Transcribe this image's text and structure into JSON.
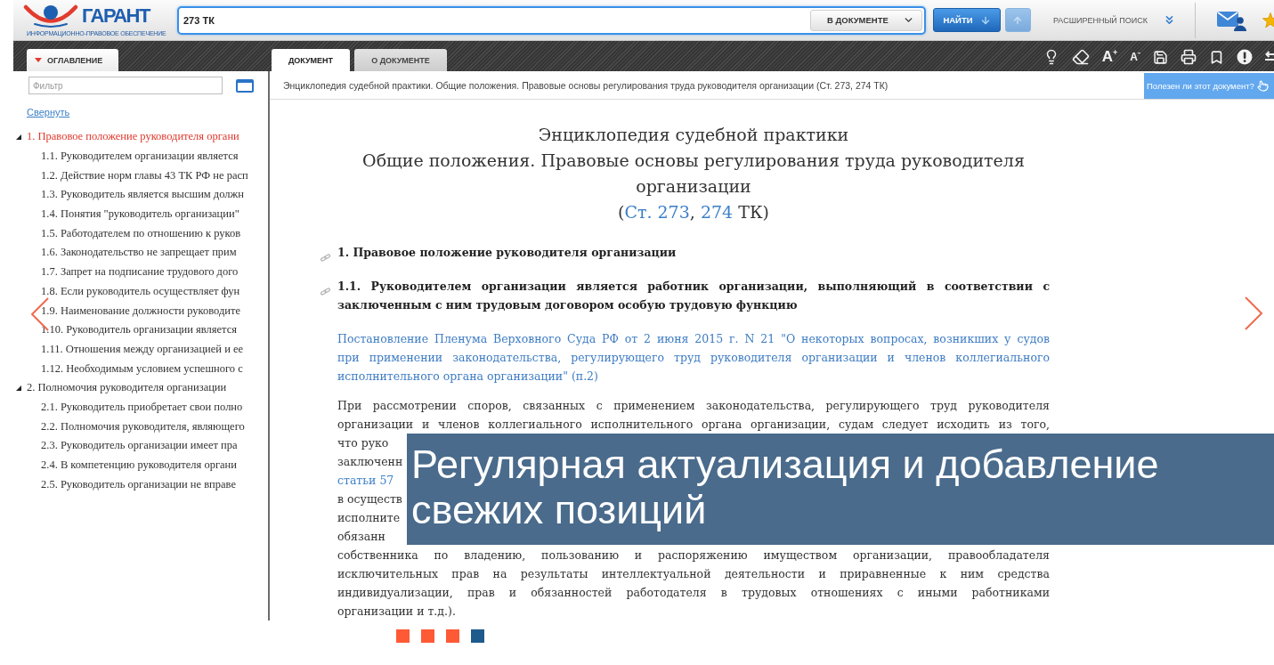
{
  "slide": {
    "logo": {
      "name": "ГАРАНТ",
      "tagline": "ИНФОРМАЦИОННО-ПРАВОВОЕ ОБЕСПЕЧЕНИЕ"
    },
    "search": {
      "value": "273 ТК",
      "scope": "В ДОКУМЕНТЕ",
      "find": "НАЙТИ",
      "previous_result": {
        "disabled": true
      },
      "advanced": "РАСШИРЕННЫЙ ПОИСК"
    },
    "sidebar": {
      "tab": "ОГЛАВЛЕНИЕ",
      "filter": {
        "placeholder": "Фильтр"
      },
      "collapse": "Свернуть",
      "items": [
        {
          "label": "1. Правовое положение руководителя органи",
          "selected": true,
          "expanded": true,
          "children": [
            {
              "label": "1.1. Руководителем организации является",
              "selected": false
            },
            {
              "label": "1.2. Действие норм главы 43 ТК РФ не расп",
              "selected": false
            },
            {
              "label": "1.3. Руководитель является высшим должн",
              "selected": false
            },
            {
              "label": "1.4. Понятия \"руководитель организации\"",
              "selected": false
            },
            {
              "label": "1.5. Работодателем по отношению к руков",
              "selected": false
            },
            {
              "label": "1.6. Законодательство не запрещает прим",
              "selected": false
            },
            {
              "label": "1.7. Запрет на подписание трудового дого",
              "selected": false
            },
            {
              "label": "1.8. Если руководитель осуществляет фун",
              "selected": false
            },
            {
              "label": "1.9. Наименование должности руководите",
              "selected": false
            },
            {
              "label": "1.10. Руководитель организации является",
              "selected": false
            },
            {
              "label": "1.11. Отношения между организацией и ее",
              "selected": false
            },
            {
              "label": "1.12. Необходимым условием успешного с",
              "selected": false
            }
          ]
        },
        {
          "label": "2. Полномочия руководителя организации",
          "selected": false,
          "expanded": true,
          "children": [
            {
              "label": "2.1. Руководитель приобретает свои полно",
              "selected": false
            },
            {
              "label": "2.2. Полномочия руководителя, являющего",
              "selected": false
            },
            {
              "label": "2.3. Руководитель организации имеет пра",
              "selected": false
            },
            {
              "label": "2.4. В компетенцию руководителя органи",
              "selected": false
            },
            {
              "label": "2.5. Руководитель организации не вправе",
              "selected": false
            }
          ]
        }
      ]
    },
    "document_tabs": [
      {
        "label": "ДОКУМЕНТ",
        "selected": true
      },
      {
        "label": "О ДОКУМЕНТЕ",
        "selected": false
      }
    ],
    "toolbar": {
      "font_larger": "A$^{+}$",
      "font_smaller": "A$^{-}$"
    },
    "breadcrumb": "Энциклопедия судебной практики. Общие положения. Правовые основы регулирования труда руководителя организации (Ст. 273, 274 ТК)",
    "feedback": "Полезен ли этот документ?",
    "document": {
      "title": "Энциклопедия судебной практики",
      "subtitle_lines": [
        "Общие положения. Правовые основы регулирования труда руководителя",
        "организации"
      ],
      "references": [
        {
          "kind": "text",
          "text": "("
        },
        {
          "kind": "link",
          "text": "Ст. 273"
        },
        {
          "kind": "text",
          "text": ", "
        },
        {
          "kind": "link",
          "text": "274"
        },
        {
          "kind": "text",
          "text": " ТК)"
        }
      ],
      "blocks": [
        {
          "kind": "heading",
          "lines": [
            {
              "parts": [
                {
                  "kind": "text",
                  "text": "1. Правовое положение руководителя организации"
                }
              ]
            }
          ]
        },
        {
          "kind": "heading",
          "lines": [
            {
              "parts": [
                {
                  "kind": "text",
                  "text": "1.1. Руководителем организации является работник организации, выполняющий в соответствии с"
                }
              ]
            },
            {
              "parts": [
                {
                  "kind": "text",
                  "text": "заключенным с ним трудовым договором особую трудовую функцию"
                }
              ]
            }
          ]
        },
        {
          "kind": "link",
          "lines": [
            {
              "parts": [
                {
                  "kind": "text",
                  "text": "Постановление Пленума Верховного Суда РФ от 2 июня 2015 г. N 21 \"О некоторых вопросах, возникших у судов"
                }
              ]
            },
            {
              "parts": [
                {
                  "kind": "text",
                  "text": "при применении законодательства, регулирующего труд руководителя организации и членов коллегиального"
                }
              ]
            },
            {
              "parts": [
                {
                  "kind": "text",
                  "text": "исполнительного органа организации\" (п.2)"
                }
              ]
            }
          ]
        },
        {
          "kind": "paragraph",
          "continued": true,
          "lines": [
            {
              "parts": [
                {
                  "kind": "text",
                  "text": "При рассмотрении споров, связанных с применением законодательства, регулирующего труд руководителя"
                }
              ]
            },
            {
              "parts": [
                {
                  "kind": "text",
                  "text": "организации и членов коллегиального исполнительного органа организации, судам следует исходить из того,"
                }
              ]
            }
          ]
        },
        {
          "kind": "fragments",
          "lines": [
            {
              "parts": [
                {
                  "kind": "text",
                  "text": "что руко"
                }
              ]
            },
            {
              "parts": [
                {
                  "kind": "text",
                  "text": "заключенн"
                }
              ]
            },
            {
              "parts": [
                {
                  "kind": "link",
                  "text": "статьи 57"
                }
              ]
            },
            {
              "parts": [
                {
                  "kind": "text",
                  "text": "в осуществ"
                }
              ]
            },
            {
              "parts": [
                {
                  "kind": "text",
                  "text": "исполните"
                }
              ]
            },
            {
              "parts": [
                {
                  "kind": "text",
                  "text": "обязанн"
                }
              ]
            }
          ]
        },
        {
          "kind": "paragraph",
          "continued": false,
          "lines": [
            {
              "parts": [
                {
                  "kind": "text",
                  "text": "собственника по владению, пользованию и распоряжению имуществом организации, правообладателя"
                }
              ]
            },
            {
              "parts": [
                {
                  "kind": "text",
                  "text": "исключительных прав на результаты интеллектуальной деятельности и приравненные к ним средства"
                }
              ]
            },
            {
              "parts": [
                {
                  "kind": "text",
                  "text": "индивидуализации, прав и обязанностей работодателя в трудовых отношениях с иными работниками"
                }
              ]
            },
            {
              "parts": [
                {
                  "kind": "text",
                  "text": "организации и т.д.)."
                }
              ]
            }
          ]
        }
      ]
    },
    "caption": "Регулярная актуализация и добавление свежих позиций"
  },
  "dots": [
    {
      "selected": false
    },
    {
      "selected": false
    },
    {
      "selected": false
    },
    {
      "selected": true
    }
  ]
}
